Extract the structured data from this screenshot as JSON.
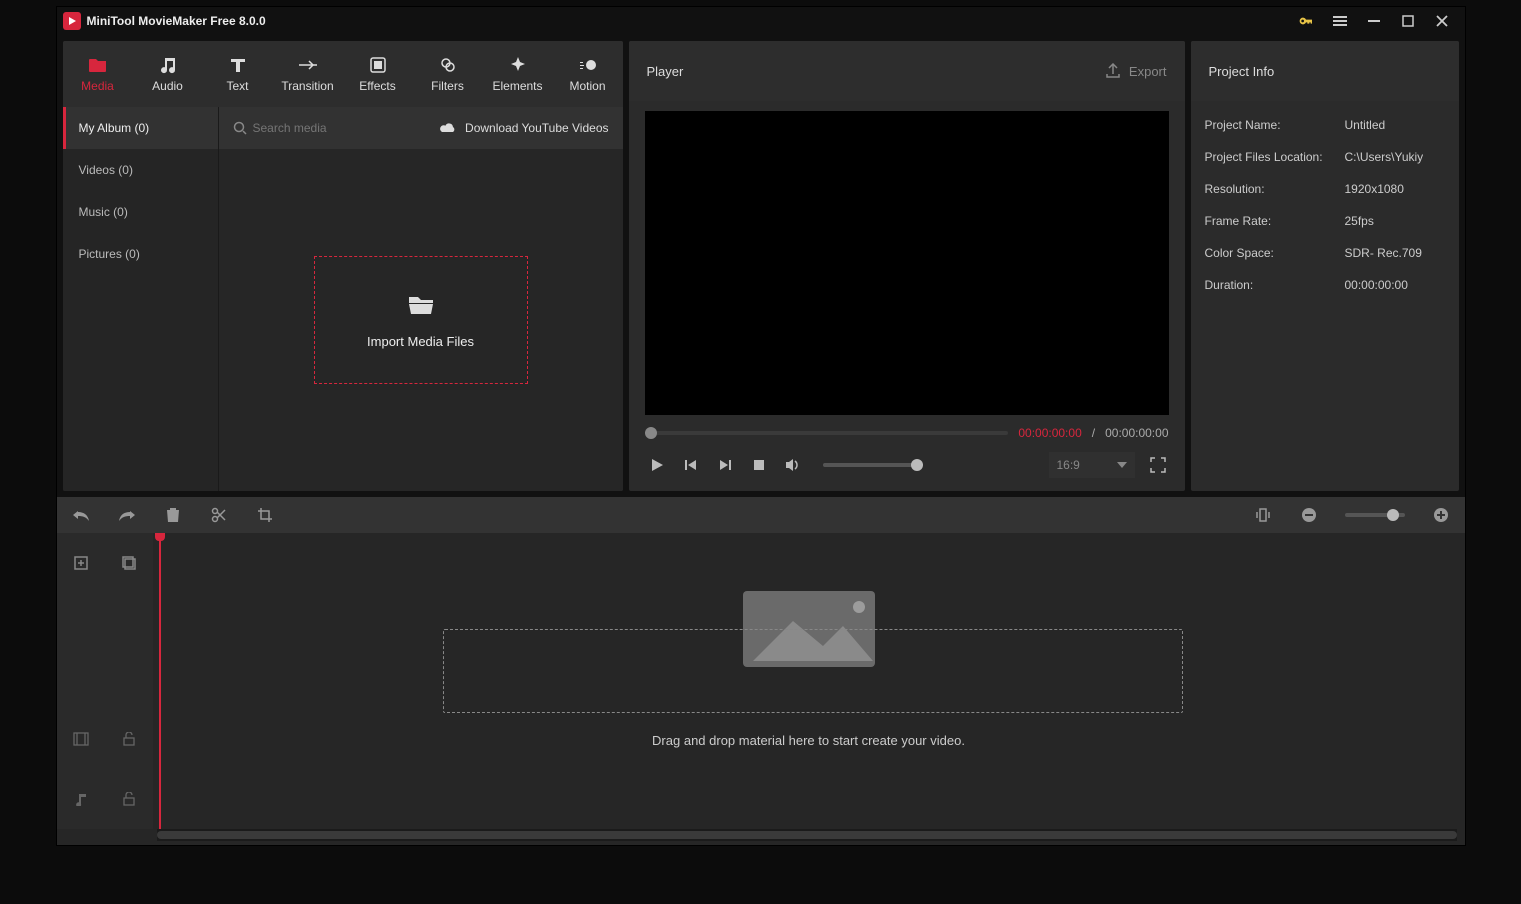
{
  "app": {
    "title": "MiniTool MovieMaker Free 8.0.0"
  },
  "tabs": [
    {
      "label": "Media"
    },
    {
      "label": "Audio"
    },
    {
      "label": "Text"
    },
    {
      "label": "Transition"
    },
    {
      "label": "Effects"
    },
    {
      "label": "Filters"
    },
    {
      "label": "Elements"
    },
    {
      "label": "Motion"
    }
  ],
  "side": [
    {
      "label": "My Album (0)"
    },
    {
      "label": "Videos (0)"
    },
    {
      "label": "Music (0)"
    },
    {
      "label": "Pictures (0)"
    }
  ],
  "media": {
    "search_placeholder": "Search media",
    "download_yt": "Download YouTube Videos",
    "import_label": "Import Media Files"
  },
  "player": {
    "title": "Player",
    "export": "Export",
    "time_current": "00:00:00:00",
    "time_sep": "/",
    "time_total": "00:00:00:00",
    "aspect": "16:9"
  },
  "info": {
    "title": "Project Info",
    "rows": [
      {
        "k": "Project Name:",
        "v": "Untitled"
      },
      {
        "k": "Project Files Location:",
        "v": "C:\\Users\\Yukiy"
      },
      {
        "k": "Resolution:",
        "v": "1920x1080"
      },
      {
        "k": "Frame Rate:",
        "v": "25fps"
      },
      {
        "k": "Color Space:",
        "v": "SDR- Rec.709"
      },
      {
        "k": "Duration:",
        "v": "00:00:00:00"
      }
    ]
  },
  "timeline": {
    "hint": "Drag and drop material here to start create your video."
  }
}
